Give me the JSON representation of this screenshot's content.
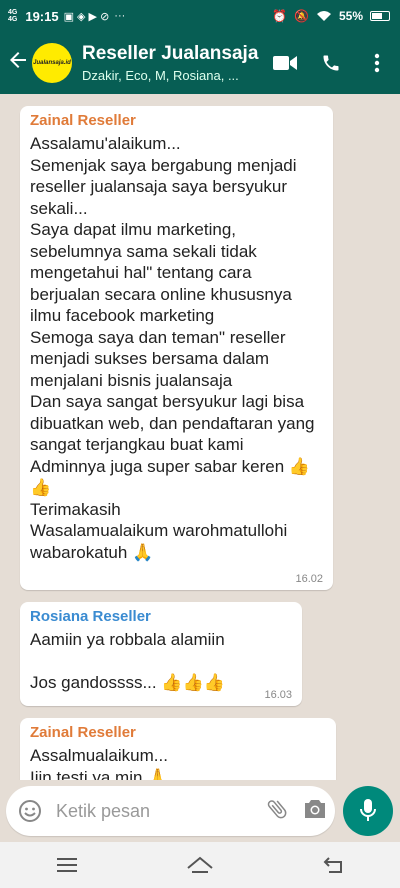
{
  "status_bar": {
    "network_top": "4G",
    "network_bottom": "4G",
    "time": "19:15",
    "overflow": "···",
    "battery": "55%"
  },
  "header": {
    "avatar_text": "Jualansaja.id",
    "title": "Reseller Jualansaja",
    "subtitle": "Dzakir, Eco, M, Rosiana, ..."
  },
  "messages": [
    {
      "sender": "Zainal Reseller",
      "text": "Assalamu'alaikum...\nSemenjak saya bergabung menjadi reseller jualansaja saya bersyukur sekali...\nSaya dapat ilmu marketing, sebelumnya sama sekali tidak mengetahui hal\" tentang cara berjualan secara online khususnya ilmu facebook marketing\nSemoga saya dan teman\" reseller menjadi sukses bersama dalam menjalani bisnis jualansaja\nDan saya sangat bersyukur lagi bisa dibuatkan web, dan pendaftaran yang sangat terjangkau buat kami\nAdminnya juga super sabar keren 👍\n👍\nTerimakasih\nWasalamualaikum warohmatullohi wabarokatuh 🙏",
      "time": "16.02"
    },
    {
      "sender": "Rosiana Reseller",
      "text": "Aamiin ya robbala alamiin\n\nJos gandossss... 👍👍👍",
      "time": "16.03"
    },
    {
      "sender": "Zainal Reseller",
      "text": "Assalmualaikum...\nIjin testi ya min 🙏",
      "time": ""
    }
  ],
  "input": {
    "placeholder": "Ketik pesan"
  },
  "colors": {
    "header": "#075E54",
    "chat_bg": "#E5DDD5",
    "mic": "#00897B",
    "sender_orange": "#E07B39",
    "sender_blue": "#3A8BD1"
  },
  "icons": [
    "back-arrow-icon",
    "video-call-icon",
    "phone-icon",
    "more-vert-icon",
    "emoji-icon",
    "attach-icon",
    "camera-icon",
    "mic-icon",
    "menu-icon",
    "home-icon",
    "back-nav-icon"
  ]
}
